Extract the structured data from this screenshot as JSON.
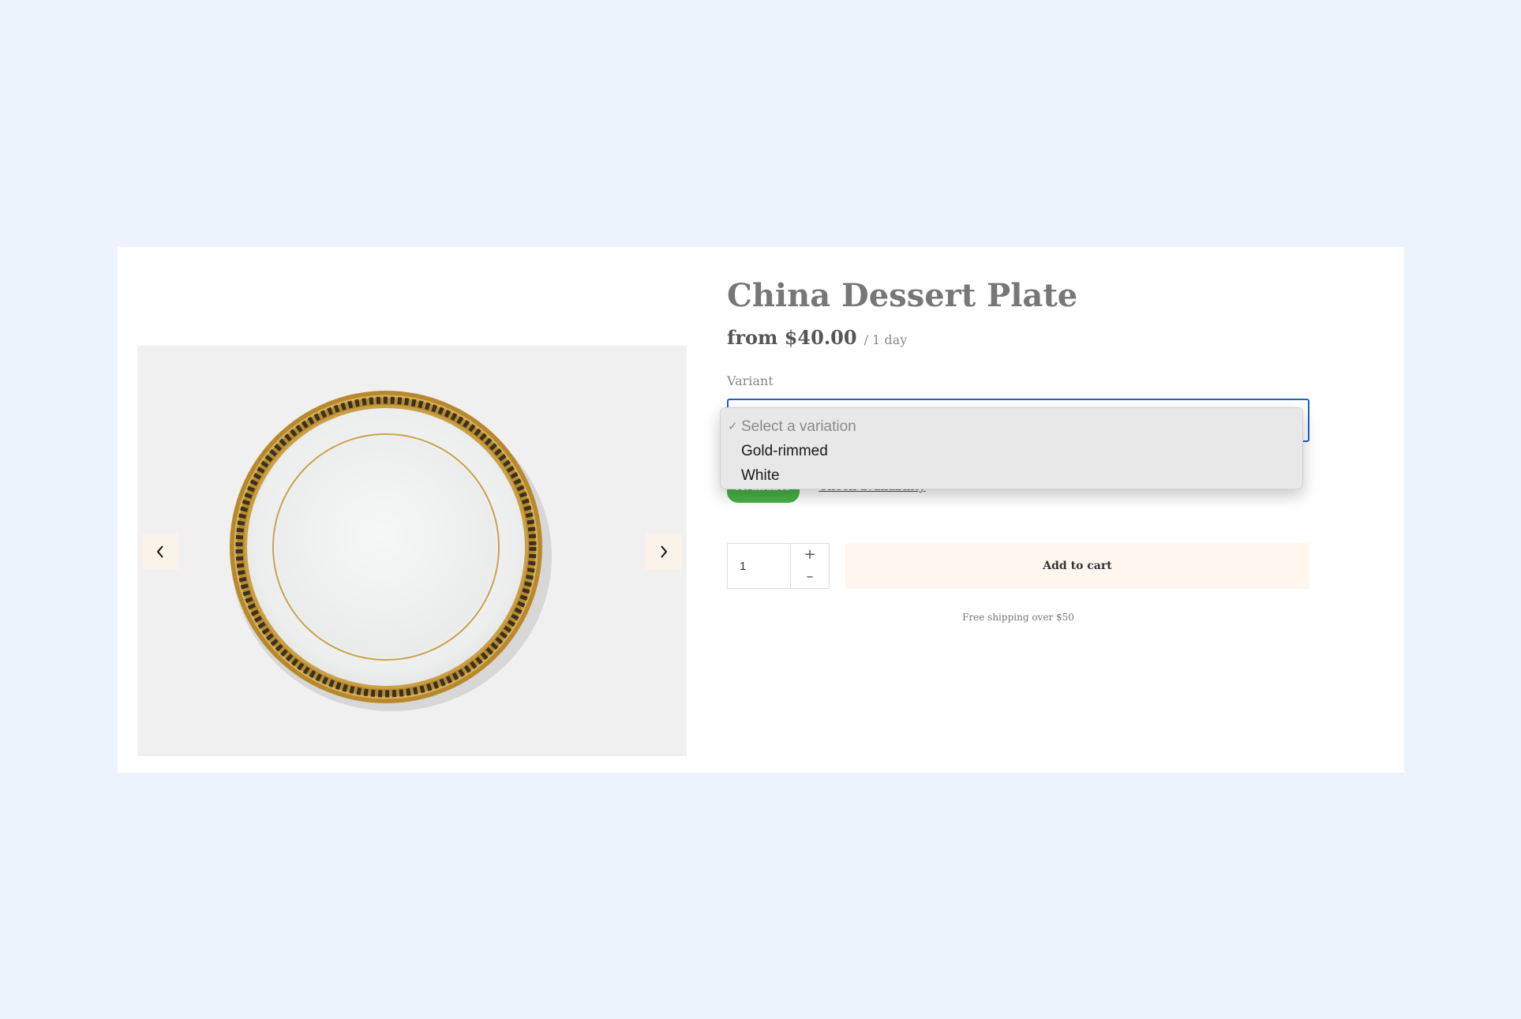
{
  "product": {
    "title": "China Dessert Plate",
    "price": "from $40.00",
    "price_period": "/ 1 day",
    "image": "white dinner plate with gold greek-key rim"
  },
  "gallery": {
    "prev_icon": "chevron-left-icon",
    "next_icon": "chevron-right-icon"
  },
  "variant": {
    "label": "Variant",
    "dropdown_open": true,
    "options": [
      {
        "label": "Select a variation",
        "selected": true
      },
      {
        "label": "Gold-rimmed",
        "selected": false
      },
      {
        "label": "White",
        "selected": false
      }
    ]
  },
  "availability": {
    "status": "Available",
    "status_color": "#47b245",
    "check_link": "Check availability"
  },
  "cart": {
    "quantity": "1",
    "plus": "+",
    "minus": "–",
    "add_label": "Add to cart",
    "shipping_note": "Free shipping over $50"
  },
  "colors": {
    "background": "#edf3fd",
    "focus_border": "#1e63c6",
    "button_bg": "#fff6ef"
  }
}
